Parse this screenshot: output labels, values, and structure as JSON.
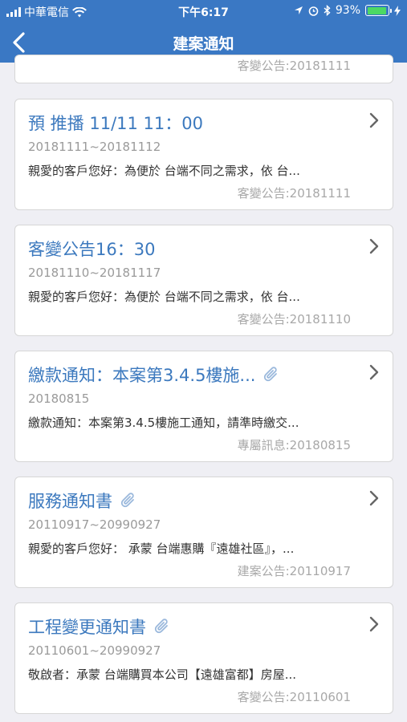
{
  "status_bar": {
    "carrier": "中華電信",
    "time": "下午6:17",
    "battery": "93%",
    "battery_level": 0.93
  },
  "nav": {
    "title": "建案通知"
  },
  "partial_card": {
    "footer": "客變公告:20181111"
  },
  "cards": [
    {
      "title": "預 推播 11/11 11：00",
      "date": "20181111~20181112",
      "summary": "親愛的客戶您好：為便於 台端不同之需求，依 台...",
      "footer": "客變公告:20181111",
      "attachment": false
    },
    {
      "title": "客變公告16：30",
      "date": "20181110~20181117",
      "summary": "親愛的客戶您好：為便於 台端不同之需求，依 台...",
      "footer": "客變公告:20181110",
      "attachment": false
    },
    {
      "title": "繳款通知：本案第3.4.5樓施...",
      "date": "20180815",
      "summary": "繳款通知：本案第3.4.5樓施工通知，請準時繳交...",
      "footer": "專屬訊息:20180815",
      "attachment": true
    },
    {
      "title": "服務通知書",
      "date": "20110917~20990927",
      "summary": "親愛的客戶您好： 承蒙 台端惠購『遠雄社區』，...",
      "footer": "建案公告:20110917",
      "attachment": true
    },
    {
      "title": "工程變更通知書",
      "date": "20110601~20990927",
      "summary": "敬啟者：承蒙 台端購買本公司【遠雄富都】房屋...",
      "footer": "客變公告:20110601",
      "attachment": true
    }
  ]
}
